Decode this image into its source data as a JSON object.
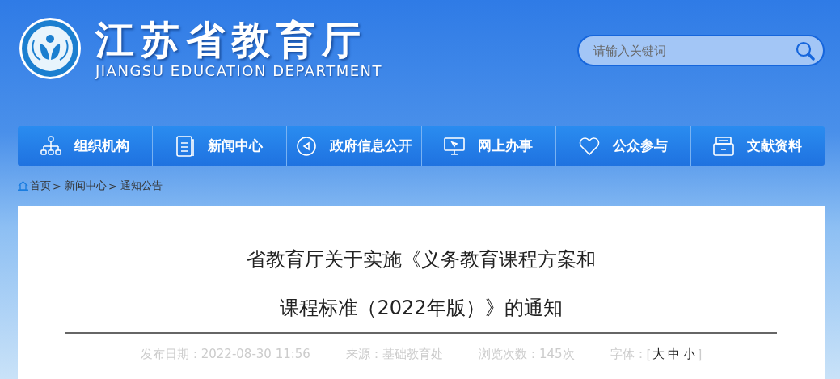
{
  "header": {
    "title": "江苏省教育厅",
    "subtitle": "JIANGSU EDUCATION DEPARTMENT"
  },
  "search": {
    "placeholder": "请输入关键词"
  },
  "nav": [
    {
      "label": "组织机构",
      "kind": "org"
    },
    {
      "label": "新闻中心",
      "kind": "doc"
    },
    {
      "label": "政府信息公开",
      "kind": "play"
    },
    {
      "label": "网上办事",
      "kind": "monitor"
    },
    {
      "label": "公众参与",
      "kind": "heart"
    },
    {
      "label": "文献资料",
      "kind": "cabinet"
    }
  ],
  "breadcrumb": [
    {
      "label": "首页",
      "separator": ">"
    },
    {
      "label": "新闻中心",
      "separator": ">"
    },
    {
      "label": "通知公告"
    }
  ],
  "article": {
    "title_lines": [
      "省教育厅关于实施《义务教育课程方案和",
      "课程标准（2022年版）》的通知"
    ],
    "meta": [
      {
        "label": "发布日期：",
        "value": "2022-08-30 11:56"
      },
      {
        "label": "来源：",
        "value": "基础教育处"
      },
      {
        "label": "浏览次数：",
        "value": "145次"
      }
    ],
    "font_size": {
      "label": "字体：",
      "open": "[",
      "options": [
        "大",
        "中",
        "小"
      ],
      "close": "]"
    }
  }
}
